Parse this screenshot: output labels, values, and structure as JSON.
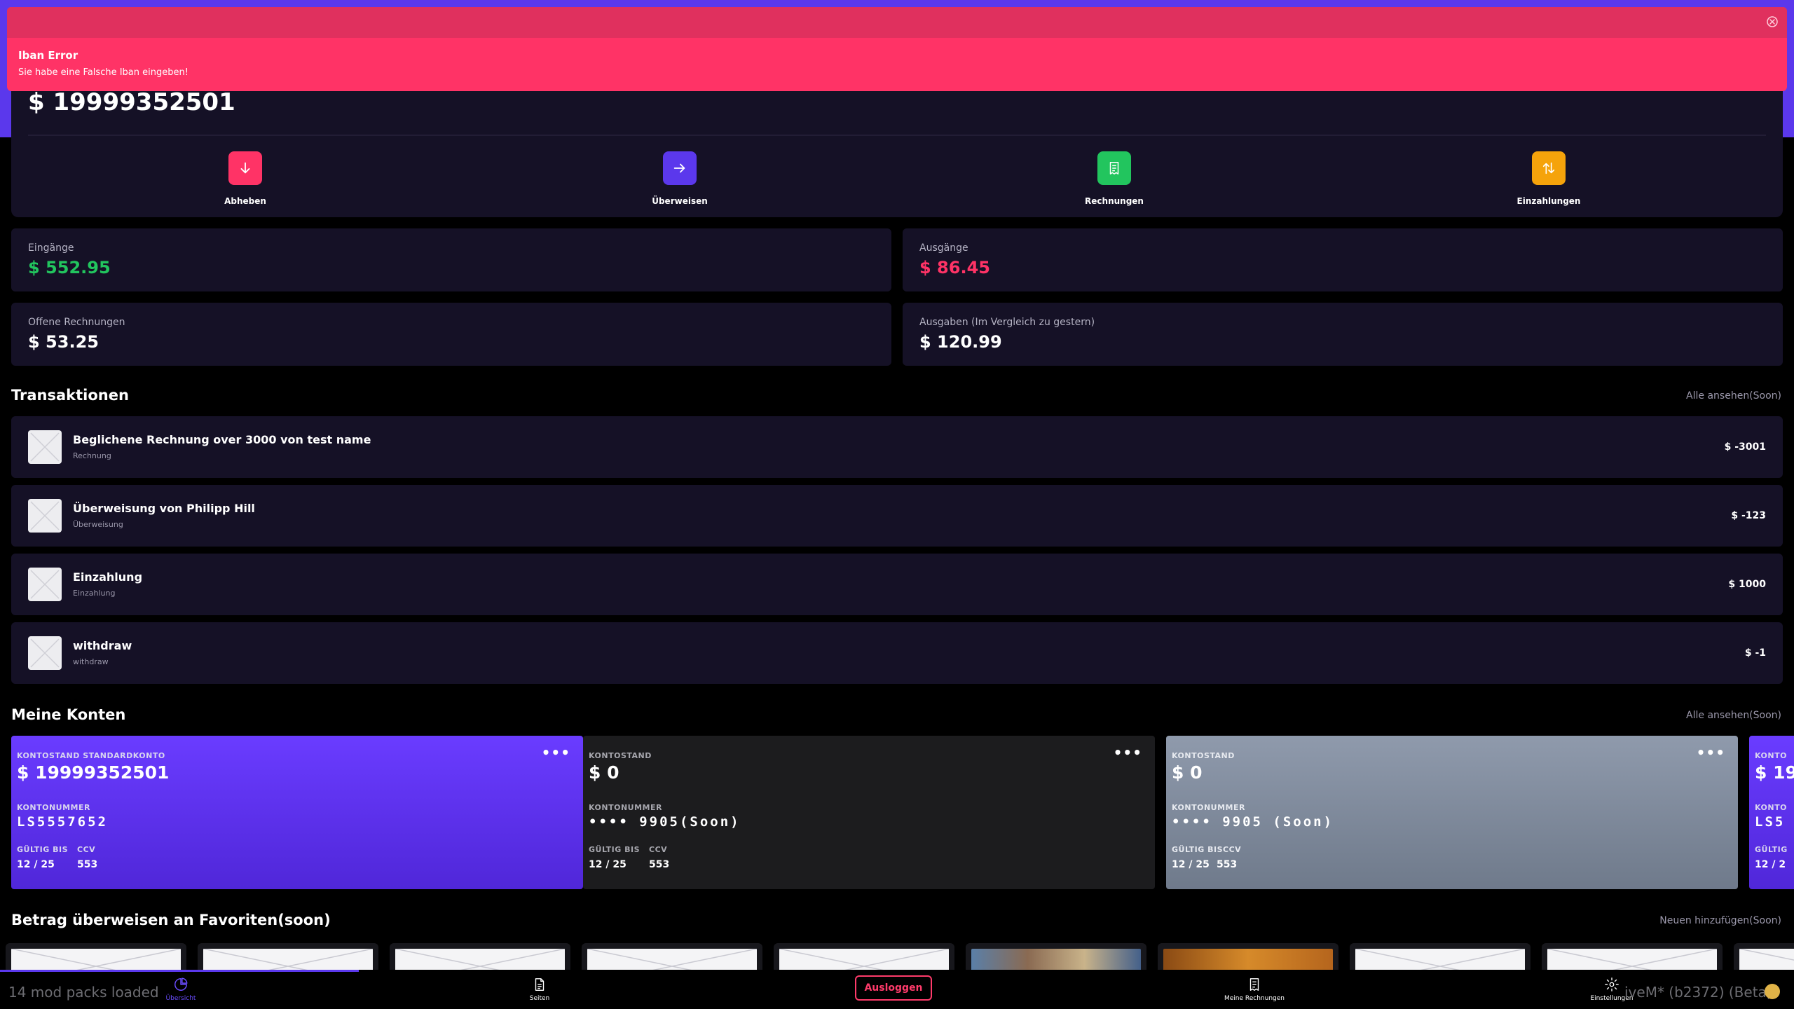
{
  "colors": {
    "accent": "#5b38ec",
    "positive": "#22c55e",
    "negative": "#ff3366",
    "warning": "#f5a30b",
    "panel": "#151126"
  },
  "toast": {
    "title": "Iban Error",
    "message": "Sie habe eine Falsche Iban eingeben!",
    "close_icon": "close-circle-icon"
  },
  "balance": {
    "amount": "$ 19999352501"
  },
  "actions": [
    {
      "label": "Abheben",
      "icon": "arrow-down-icon",
      "color": "#ff3366"
    },
    {
      "label": "Überweisen",
      "icon": "arrow-right-icon",
      "color": "#5b38ec"
    },
    {
      "label": "Rechnungen",
      "icon": "receipt-icon",
      "color": "#22c55e"
    },
    {
      "label": "Einzahlungen",
      "icon": "swap-vertical-icon",
      "color": "#f5a30b"
    }
  ],
  "stats": {
    "income": {
      "label": "Eingänge",
      "value": "$ 552.95"
    },
    "expenses": {
      "label": "Ausgänge",
      "value": "$ 86.45"
    },
    "open_bills": {
      "label": "Offene Rechnungen",
      "value": "$ 53.25"
    },
    "spending_vs_yesterday": {
      "label": "Ausgaben (Im Vergleich zu gestern)",
      "value": "$ 120.99"
    }
  },
  "transactions": {
    "title": "Transaktionen",
    "view_all": "Alle ansehen(Soon)",
    "items": [
      {
        "title": "Beglichene Rechnung over 3000 von test name",
        "type": "Rechnung",
        "amount": "$ -3001"
      },
      {
        "title": "Überweisung von Philipp Hill",
        "type": "Überweisung",
        "amount": "$ -123"
      },
      {
        "title": "Einzahlung",
        "type": "Einzahlung",
        "amount": "$ 1000"
      },
      {
        "title": "withdraw",
        "type": "withdraw",
        "amount": "$ -1"
      }
    ]
  },
  "accounts": {
    "title": "Meine Konten",
    "view_all": "Alle ansehen(Soon)",
    "items": [
      {
        "balance_label": "KONTOSTAND STANDARDKONTO",
        "balance": "$ 19999352501",
        "number_label": "KONTONUMMER",
        "number": "LS5557652",
        "valid_label": "GÜLTIG BIS",
        "valid": "12 / 25",
        "ccv_label": "CCV",
        "ccv": "553",
        "menu": "•••"
      },
      {
        "balance_label": "KONTOSTAND",
        "balance": "$ 0",
        "number_label": "KONTONUMMER",
        "number": "•••• 9905(Soon)",
        "valid_label": "GÜLTIG BIS",
        "valid": "12 / 25",
        "ccv_label": "CCV",
        "ccv": "553",
        "menu": "•••"
      },
      {
        "balance_label": "KONTOSTAND",
        "balance": "$ 0",
        "number_label": "KONTONUMMER",
        "number": "•••• 9905 (Soon)",
        "valid_combined_label": "GÜLTIG BISCCV",
        "valid": "12 / 25",
        "ccv": "553",
        "menu": "•••"
      },
      {
        "balance_label": "KONTO",
        "balance": "$ 19",
        "number_label": "KONTO",
        "number": "LS5",
        "valid_label": "GÜLTIG",
        "valid": "12 / 2"
      }
    ]
  },
  "favorites": {
    "title": "Betrag überweisen an Favoriten(soon)",
    "add_new": "Neuen hinzufügen(Soon)"
  },
  "nav": {
    "overview": "Übersicht",
    "pages": "Seiten",
    "logout": "Ausloggen",
    "my_bills": "Meine Rechnungen",
    "settings": "Einstellungen"
  },
  "overlay": {
    "left": "14 mod packs loaded",
    "right": "iveM* (b2372) (Beta)"
  }
}
